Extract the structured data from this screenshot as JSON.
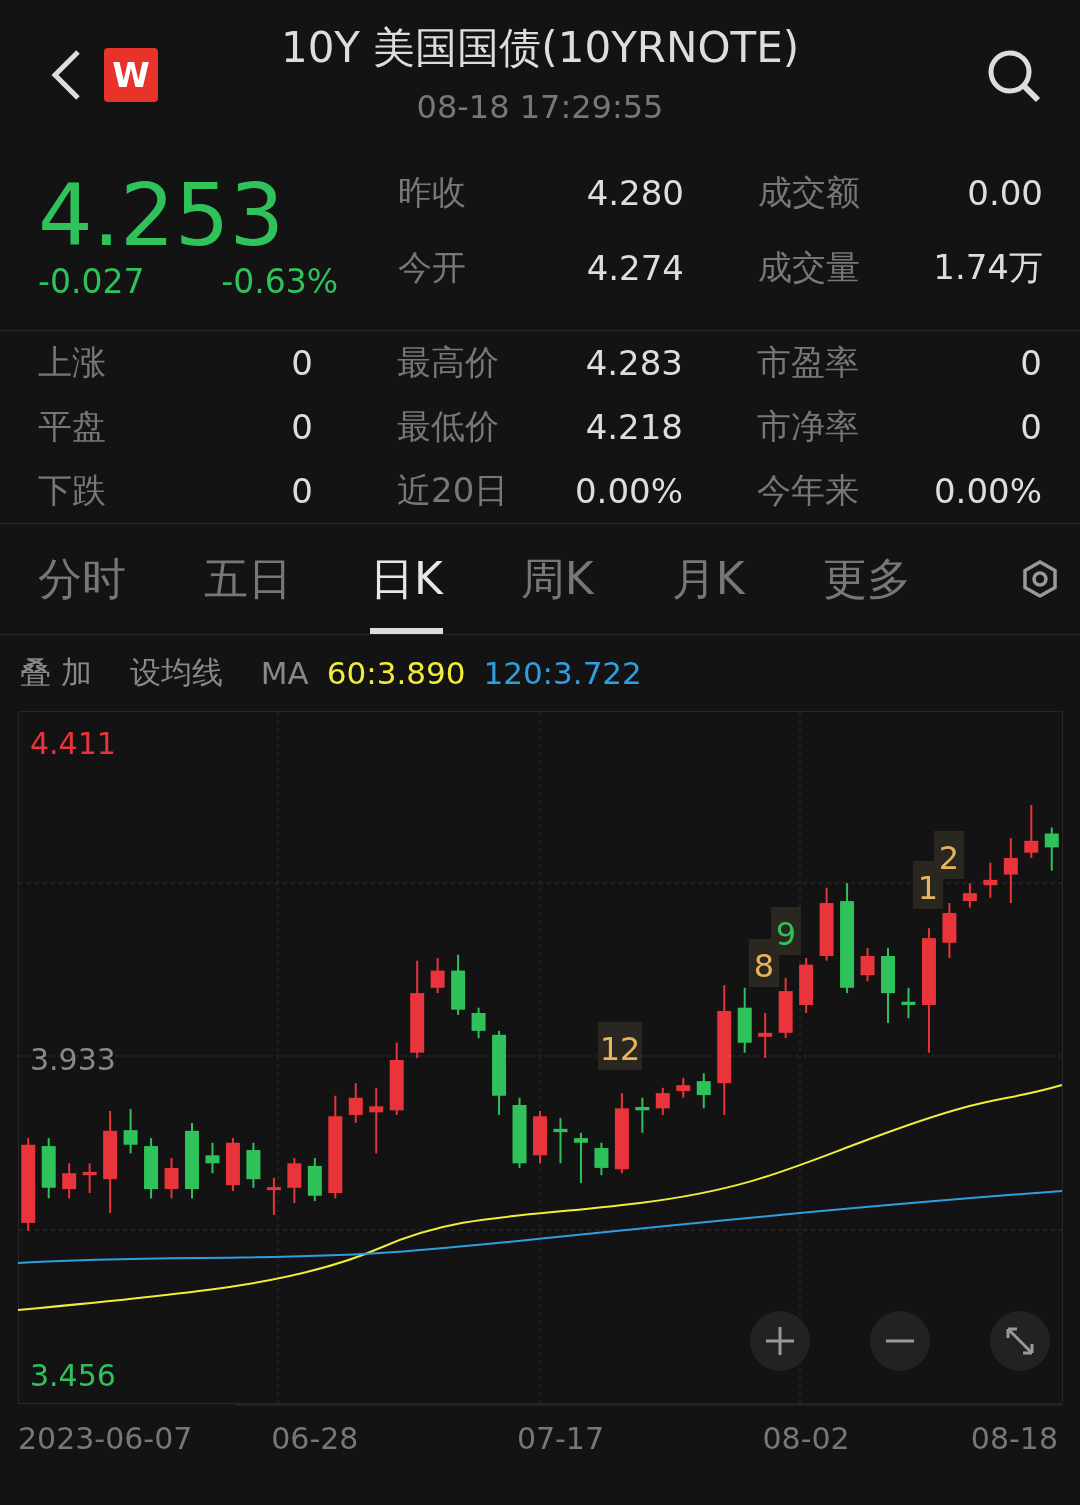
{
  "header": {
    "title": "10Y 美国国债(10YRNOTE)",
    "time": "08-18 17:29:55",
    "logo": "W"
  },
  "quote": {
    "price": "4.253",
    "change": "-0.027",
    "change_pct": "-0.63%"
  },
  "stats": [
    {
      "label": "昨收",
      "value": "4.280"
    },
    {
      "label": "成交额",
      "value": "0.00"
    },
    {
      "label": "今开",
      "value": "4.274"
    },
    {
      "label": "成交量",
      "value": "1.74万"
    }
  ],
  "breadth": [
    {
      "label": "上涨",
      "value": "0"
    },
    {
      "label": "最高价",
      "value": "4.283"
    },
    {
      "label": "市盈率",
      "value": "0"
    },
    {
      "label": "平盘",
      "value": "0"
    },
    {
      "label": "最低价",
      "value": "4.218"
    },
    {
      "label": "市净率",
      "value": "0"
    },
    {
      "label": "下跌",
      "value": "0"
    },
    {
      "label": "近20日",
      "value": "0.00%"
    },
    {
      "label": "今年来",
      "value": "0.00%"
    }
  ],
  "tabs": [
    {
      "label": "分时",
      "selected": false
    },
    {
      "label": "五日",
      "selected": false
    },
    {
      "label": "日K",
      "selected": true
    },
    {
      "label": "周K",
      "selected": false
    },
    {
      "label": "月K",
      "selected": false
    },
    {
      "label": "更多",
      "selected": false
    }
  ],
  "toolbar": {
    "overlay": "叠 加",
    "set_ma": "设均线",
    "ma": "MA",
    "ma_lines": [
      {
        "label": "60:3.890",
        "color": "#f2ec3a"
      },
      {
        "label": "120:3.722",
        "color": "#2f9fe0"
      }
    ]
  },
  "chart": {
    "range_start": "2023-06-07",
    "range_end": "08-18",
    "chart_data": {
      "type": "candlestick",
      "categories": [
        null,
        null,
        null,
        null,
        null,
        null,
        null,
        null,
        null,
        null,
        null,
        null,
        null,
        null,
        "06-28",
        null,
        null,
        null,
        null,
        null,
        null,
        null,
        null,
        null,
        null,
        null,
        "07-17",
        null,
        null,
        null,
        null,
        null,
        null,
        null,
        null,
        null,
        null,
        null,
        "08-02",
        null,
        null,
        null,
        null,
        null,
        null,
        null,
        null,
        null,
        null,
        null,
        null
      ],
      "ohlc": [
        [
          3.686,
          3.814,
          3.674,
          3.804
        ],
        [
          3.802,
          3.814,
          3.723,
          3.739
        ],
        [
          3.737,
          3.776,
          3.723,
          3.761
        ],
        [
          3.758,
          3.776,
          3.731,
          3.763
        ],
        [
          3.752,
          3.855,
          3.701,
          3.825
        ],
        [
          3.826,
          3.858,
          3.791,
          3.804
        ],
        [
          3.802,
          3.814,
          3.723,
          3.737
        ],
        [
          3.737,
          3.784,
          3.723,
          3.769
        ],
        [
          3.825,
          3.837,
          3.723,
          3.737
        ],
        [
          3.788,
          3.807,
          3.761,
          3.776
        ],
        [
          3.743,
          3.814,
          3.734,
          3.807
        ],
        [
          3.796,
          3.807,
          3.739,
          3.752
        ],
        [
          3.736,
          3.754,
          3.698,
          3.74
        ],
        [
          3.739,
          3.784,
          3.716,
          3.776
        ],
        [
          3.772,
          3.784,
          3.719,
          3.727
        ],
        [
          3.731,
          3.878,
          3.723,
          3.847
        ],
        [
          3.849,
          3.897,
          3.837,
          3.875
        ],
        [
          3.853,
          3.89,
          3.791,
          3.862
        ],
        [
          3.856,
          3.958,
          3.849,
          3.932
        ],
        [
          3.943,
          4.082,
          3.935,
          4.033
        ],
        [
          4.041,
          4.086,
          4.033,
          4.067
        ],
        [
          4.067,
          4.091,
          4.0,
          4.008
        ],
        [
          4.003,
          4.011,
          3.965,
          3.976
        ],
        [
          3.97,
          3.976,
          3.849,
          3.878
        ],
        [
          3.864,
          3.875,
          3.769,
          3.776
        ],
        [
          3.788,
          3.855,
          3.776,
          3.847
        ],
        [
          3.828,
          3.844,
          3.776,
          3.823
        ],
        [
          3.814,
          3.822,
          3.746,
          3.807
        ],
        [
          3.799,
          3.807,
          3.758,
          3.769
        ],
        [
          3.767,
          3.882,
          3.761,
          3.859
        ],
        [
          3.861,
          3.875,
          3.822,
          3.856
        ],
        [
          3.859,
          3.89,
          3.849,
          3.882
        ],
        [
          3.885,
          3.905,
          3.875,
          3.894
        ],
        [
          3.9,
          3.912,
          3.859,
          3.879
        ],
        [
          3.897,
          4.045,
          3.849,
          4.006
        ],
        [
          4.011,
          4.041,
          3.943,
          3.958
        ],
        [
          3.967,
          4.003,
          3.935,
          3.973
        ],
        [
          3.973,
          4.056,
          3.965,
          4.036
        ],
        [
          4.015,
          4.086,
          4.003,
          4.076
        ],
        [
          4.089,
          4.192,
          4.082,
          4.169
        ],
        [
          4.172,
          4.199,
          4.033,
          4.041
        ],
        [
          4.06,
          4.101,
          4.051,
          4.089
        ],
        [
          4.089,
          4.101,
          3.988,
          4.033
        ],
        [
          4.02,
          4.041,
          3.995,
          4.015
        ],
        [
          4.015,
          4.131,
          3.943,
          4.116
        ],
        [
          4.109,
          4.169,
          4.086,
          4.154
        ],
        [
          4.172,
          4.199,
          4.162,
          4.184
        ],
        [
          4.196,
          4.23,
          4.177,
          4.204
        ],
        [
          4.212,
          4.267,
          4.169,
          4.237
        ],
        [
          4.245,
          4.317,
          4.237,
          4.263
        ],
        [
          4.274,
          4.283,
          4.218,
          4.253
        ]
      ],
      "ylim": [
        3.414,
        4.459
      ],
      "yticks": [
        {
          "value": 4.411,
          "label": "4.411"
        },
        {
          "value": 3.933,
          "label": "3.933"
        },
        {
          "value": 3.456,
          "label": "3.456"
        }
      ]
    },
    "markers": [
      {
        "text": "12",
        "color": "#e8b45a"
      },
      {
        "text": "8",
        "color": "#e8b45a"
      },
      {
        "text": "9",
        "color": "#2fc25b"
      },
      {
        "text": "1",
        "color": "#e8b45a"
      },
      {
        "text": "2",
        "color": "#e8b45a"
      }
    ]
  }
}
